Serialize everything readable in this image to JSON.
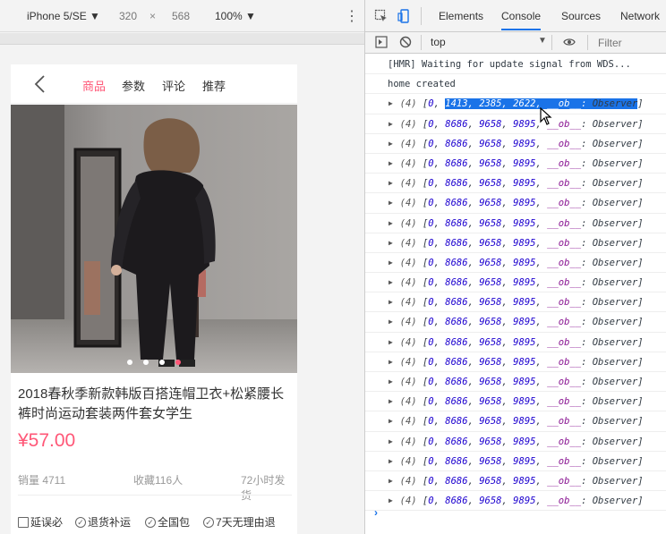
{
  "device_toolbar": {
    "device": "iPhone 5/SE ▼",
    "width": "320",
    "times": "×",
    "height": "568",
    "zoom": "100% ▼",
    "more": "⋮"
  },
  "page": {
    "tabs": [
      "商品",
      "参数",
      "评论",
      "推荐"
    ],
    "active_tab_index": 0,
    "carousel": {
      "count": 4,
      "active_index": 3
    },
    "title": "2018春秋季新款韩版百搭连帽卫衣+松紧腰长裤时尚运动套装两件套女学生",
    "price": "¥57.00",
    "stats": {
      "sales": "销量 4711",
      "favorites": "收藏116人",
      "shipping": "72小时发货"
    },
    "services": [
      "延误必",
      "退货补运",
      "全国包",
      "7天无理由退"
    ],
    "accent_color": "#ff5777"
  },
  "devtools": {
    "tabs": [
      "Elements",
      "Console",
      "Sources",
      "Network"
    ],
    "active_tab": "Console",
    "context": "top",
    "context_arrow": "▼",
    "filter_placeholder": "Filter",
    "accent_color": "#1a73e8"
  },
  "console": {
    "lines": [
      "[HMR] Waiting for update signal from WDS...",
      "home created"
    ],
    "first_array": {
      "count": "(4)",
      "values": [
        "0",
        "1413",
        "2385",
        "2622"
      ],
      "key": "__ob__",
      "val": "Observer"
    },
    "repeated_array": {
      "count": "(4)",
      "values": [
        "0",
        "8686",
        "9658",
        "9895"
      ],
      "key": "__ob__",
      "val": "Observer",
      "times": 20
    },
    "prompt": "›"
  }
}
